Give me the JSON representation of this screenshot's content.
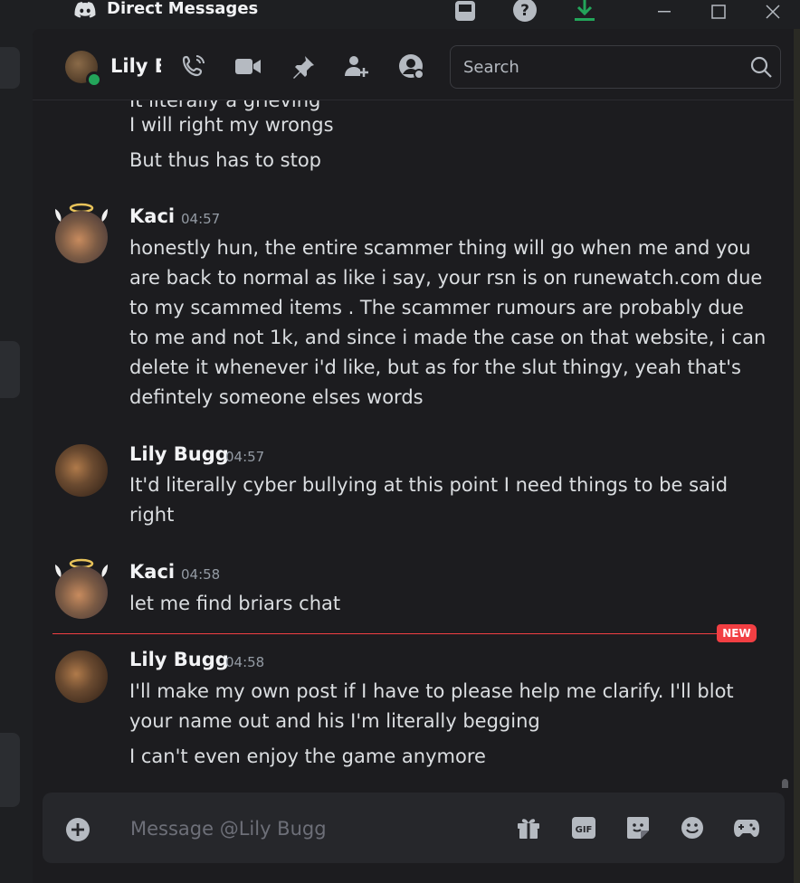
{
  "window": {
    "title": "Direct Messages",
    "controls": [
      "inbox-icon",
      "help-icon",
      "download-icon",
      "minimize-icon",
      "maximize-icon",
      "close-icon"
    ]
  },
  "header": {
    "recipient_name": "Lily Bugg",
    "recipient_status_color": "#23a55a",
    "icons": [
      "voice-call-icon",
      "video-call-icon",
      "pin-icon",
      "add-friends-icon",
      "user-profile-icon"
    ],
    "search_placeholder": "Search"
  },
  "messages": {
    "partial_line": "It literally a grieving",
    "groups": [
      {
        "lines": [
          "I will right my wrongs",
          "But thus has to stop"
        ]
      },
      {
        "author": "Kaci",
        "time": "04:57",
        "lines": [
          "honestly hun, the entire scammer thing will go when me and you",
          "are back to normal as like i say, your rsn is on runewatch.com due",
          "to my scammed items . The scammer rumours are probably due",
          "to me and not 1k, and since i made the case on that website, i can",
          "delete it whenever i'd like, but  as for the slut thingy, yeah that's",
          "defintely someone elses words"
        ]
      },
      {
        "author": "Lily Bugg",
        "time": "04:57",
        "lines": [
          "It'd literally cyber bullying at this point I need things to be said",
          "right"
        ]
      },
      {
        "author": "Kaci",
        "time": "04:58",
        "lines": [
          "let me find briars chat"
        ]
      },
      {
        "author": "Lily Bugg",
        "time": "04:58",
        "lines": [
          "I'll make my own post if I have to please help me clarify. I'll blot",
          "your name out and his I'm literally begging",
          "I can't even enjoy the game anymore"
        ]
      }
    ],
    "new_divider_label": "NEW"
  },
  "composer": {
    "placeholder": "Message @Lily Bugg",
    "icons": [
      "gift-icon",
      "gif-icon",
      "sticker-icon",
      "emoji-icon",
      "activity-icon"
    ],
    "gif_label": "GIF"
  },
  "colors": {
    "background": "#1c1c1f",
    "accent_red": "#f23f43",
    "online_green": "#23a55a",
    "text": "#dbdee1",
    "muted": "#949ba4"
  }
}
